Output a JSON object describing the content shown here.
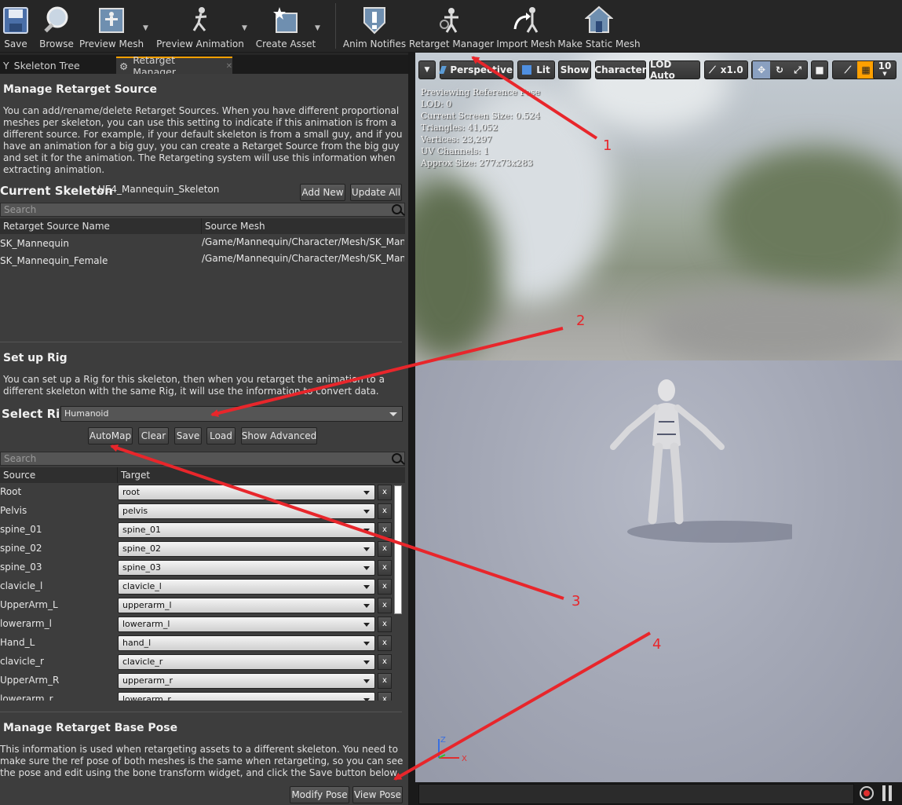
{
  "toolbar": {
    "items": [
      {
        "label": "Save",
        "icon": "floppy-disk-icon"
      },
      {
        "label": "Browse",
        "icon": "magnifier-icon"
      },
      {
        "label": "Preview Mesh",
        "icon": "mesh-icon"
      },
      {
        "label": "Preview Animation",
        "icon": "running-figure-icon"
      },
      {
        "label": "Create Asset",
        "icon": "star-asset-icon"
      },
      {
        "label": "Anim Notifies",
        "icon": "exclamation-shield-icon"
      },
      {
        "label": "Retarget Manager",
        "icon": "retarget-figure-icon"
      },
      {
        "label": "Import Mesh",
        "icon": "import-arrow-figure-icon"
      },
      {
        "label": "Make Static Mesh",
        "icon": "house-icon"
      }
    ]
  },
  "tabs": [
    {
      "label": "Skeleton Tree",
      "icon": "skeleton-icon"
    },
    {
      "label": "Retarget Manager",
      "icon": "retarget-icon"
    }
  ],
  "source_section": {
    "heading": "Manage Retarget Source",
    "description": "You can add/rename/delete Retarget Sources. When you have different proportional meshes per skeleton, you can use this setting to indicate if this animation is from a different source. For example, if your default skeleton is from a small guy, and if you have an animation for a big guy, you can create a Retarget Source from the big guy and set it for the animation. The Retargeting system will use this information when extracting animation.",
    "current_skeleton_label": "Current Skeleton",
    "current_skeleton_value": "UE4_Mannequin_Skeleton",
    "add_new": "Add New",
    "update_all": "Update All",
    "search_placeholder": "Search",
    "columns": [
      "Retarget Source Name",
      "Source Mesh"
    ],
    "rows": [
      {
        "name": "SK_Mannequin",
        "mesh": "/Game/Mannequin/Character/Mesh/SK_Mannequin"
      },
      {
        "name": "SK_Mannequin_Female",
        "mesh": "/Game/Mannequin/Character/Mesh/SK_Mannequin_Female"
      }
    ]
  },
  "rig_section": {
    "heading": "Set up Rig",
    "description": "You can set up a Rig for this skeleton, then when you retarget the animation to a different skeleton with the same Rig, it will use the information to convert data.",
    "select_rig_label": "Select Rig",
    "selected_rig": "Humanoid",
    "buttons": {
      "automap": "AutoMap",
      "clear": "Clear",
      "save": "Save",
      "load": "Load",
      "show_advanced": "Show Advanced"
    },
    "search_placeholder": "Search",
    "columns": [
      "Source",
      "Target"
    ],
    "mappings": [
      {
        "source": "Root",
        "target": "root"
      },
      {
        "source": "Pelvis",
        "target": "pelvis"
      },
      {
        "source": "spine_01",
        "target": "spine_01"
      },
      {
        "source": "spine_02",
        "target": "spine_02"
      },
      {
        "source": "spine_03",
        "target": "spine_03"
      },
      {
        "source": "clavicle_l",
        "target": "clavicle_l"
      },
      {
        "source": "UpperArm_L",
        "target": "upperarm_l"
      },
      {
        "source": "lowerarm_l",
        "target": "lowerarm_l"
      },
      {
        "source": "Hand_L",
        "target": "hand_l"
      },
      {
        "source": "clavicle_r",
        "target": "clavicle_r"
      },
      {
        "source": "UpperArm_R",
        "target": "upperarm_r"
      },
      {
        "source": "lowerarm_r",
        "target": "lowerarm_r"
      }
    ],
    "clear_label": "x"
  },
  "base_pose_section": {
    "heading": "Manage Retarget Base Pose",
    "description": "This information is used when retargeting assets to a different skeleton. You need to make sure the ref pose of both meshes is the same when retargeting, so you can see the pose and edit using the bone transform widget, and click the Save button below.",
    "modify_pose": "Modify Pose",
    "view_pose": "View Pose"
  },
  "viewport": {
    "toolbar": {
      "perspective": "Perspective",
      "lit": "Lit",
      "show": "Show",
      "character": "Character",
      "lod": "LOD Auto",
      "speed": "x1.0",
      "grid_size": "10"
    },
    "stats": [
      "Previewing Reference Pose",
      "LOD: 0",
      "Current Screen Size: 0.524",
      "Triangles: 41,052",
      "Vertices: 23,297",
      "UV Channels: 1",
      "Approx Size: 277x73x283"
    ],
    "axis": {
      "z": "Z",
      "x": "X"
    }
  },
  "annotations": [
    "1",
    "2",
    "3",
    "4"
  ],
  "colors": {
    "accent": "#ffa000",
    "annotation": "#e8262b",
    "panel": "#3d3d3d"
  }
}
